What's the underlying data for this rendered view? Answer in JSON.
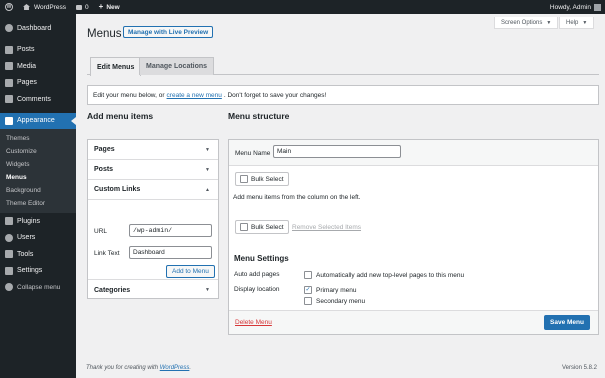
{
  "adminbar": {
    "site_name": "WordPress",
    "comments_count": "0",
    "new_label": "New",
    "greeting": "Howdy, Admin"
  },
  "sidebar": {
    "items": [
      {
        "label": "Dashboard",
        "icon": "dashboard-icon"
      },
      {
        "label": "Posts",
        "icon": "pin-icon"
      },
      {
        "label": "Media",
        "icon": "media-icon"
      },
      {
        "label": "Pages",
        "icon": "pages-icon"
      },
      {
        "label": "Comments",
        "icon": "comments-icon"
      },
      {
        "label": "Appearance",
        "icon": "paintbrush-icon"
      },
      {
        "label": "Plugins",
        "icon": "plugins-icon"
      },
      {
        "label": "Users",
        "icon": "users-icon"
      },
      {
        "label": "Tools",
        "icon": "tools-icon"
      },
      {
        "label": "Settings",
        "icon": "settings-icon"
      },
      {
        "label": "Collapse menu",
        "icon": "collapse-icon"
      }
    ],
    "appearance_sub": [
      "Themes",
      "Customize",
      "Widgets",
      "Menus",
      "Background",
      "Theme Editor"
    ]
  },
  "header": {
    "screen_options": "Screen Options",
    "help": "Help",
    "title": "Menus",
    "preview_button": "Manage with Live Preview"
  },
  "tabs": [
    "Edit Menus",
    "Manage Locations"
  ],
  "notice": {
    "before": "Edit your menu below, or",
    "link": "create a new menu",
    "after": ". Don't forget to save your changes!"
  },
  "add_items": {
    "heading": "Add menu items",
    "sections": [
      "Pages",
      "Posts",
      "Custom Links",
      "Categories"
    ],
    "url_label": "URL",
    "url_value": "/wp-admin/",
    "link_text_label": "Link Text",
    "link_text_value": "Dashboard",
    "add_button": "Add to Menu"
  },
  "structure": {
    "heading": "Menu structure",
    "menu_name_label": "Menu Name",
    "menu_name_value": "Main",
    "bulk_select": "Bulk Select",
    "hint": "Add menu items from the column on the left.",
    "remove_selected": "Remove Selected Items",
    "settings_heading": "Menu Settings",
    "auto_add_label": "Auto add pages",
    "auto_add_option": "Automatically add new top-level pages to this menu",
    "display_location_label": "Display location",
    "locations": [
      {
        "label": "Primary menu",
        "checked": true
      },
      {
        "label": "Secondary menu",
        "checked": false
      }
    ],
    "delete_link": "Delete Menu",
    "save_button": "Save Menu"
  },
  "footer": {
    "thanks_before": "Thank you for creating with",
    "thanks_link": "WordPress",
    "thanks_after": ".",
    "version": "Version 5.8.2"
  },
  "colors": {
    "accent": "#2271b1",
    "sidebar_bg": "#1d2327",
    "danger": "#d63638"
  }
}
